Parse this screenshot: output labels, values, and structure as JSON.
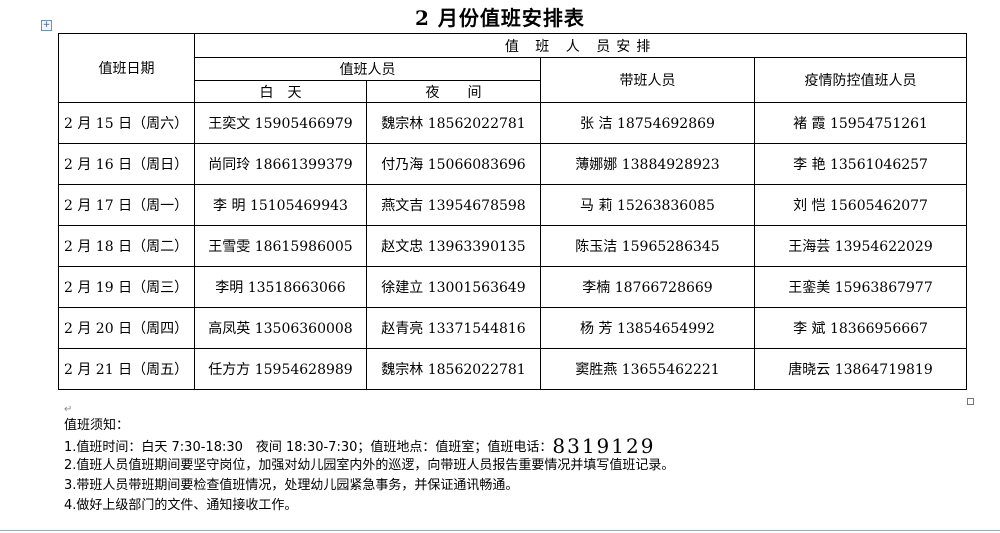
{
  "title": "2 月份值班安排表",
  "table": {
    "date_header": "值班日期",
    "arrangement_header": "值 班 人 员安排",
    "duty_staff_header": "值班人员",
    "day_header": "白　天",
    "night_header": "夜　　间",
    "lead_header": "带班人员",
    "epidemic_header": "疫情防控值班人员",
    "rows": [
      {
        "date": "2 月 15 日（周六）",
        "day": "王奕文 15905466979",
        "night": "魏宗林 18562022781",
        "lead": "张 洁 18754692869",
        "epi": "褚 霞 15954751261"
      },
      {
        "date": "2 月 16 日（周日）",
        "day": "尚同玲 18661399379",
        "night": "付乃海 15066083696",
        "lead": "薄娜娜 13884928923",
        "epi": "李 艳 13561046257"
      },
      {
        "date": "2 月 17 日（周一）",
        "day": "李 明 15105469943",
        "night": "燕文吉 13954678598",
        "lead": "马 莉 15263836085",
        "epi": "刘 恺 15605462077"
      },
      {
        "date": "2 月 18 日（周二）",
        "day": "王雪雯 18615986005",
        "night": "赵文忠 13963390135",
        "lead": "陈玉洁 15965286345",
        "epi": "王海芸 13954622029"
      },
      {
        "date": "2 月 19 日（周三）",
        "day": "李明 13518663066",
        "night": "徐建立 13001563649",
        "lead": "李楠 18766728669",
        "epi": "王銮美 15963867977"
      },
      {
        "date": "2 月 20 日（周四）",
        "day": "高凤英 13506360008",
        "night": "赵青亮 13371544816",
        "lead": "杨 芳 13854654992",
        "epi": "李 斌 18366956667"
      },
      {
        "date": "2 月 21 日（周五）",
        "day": "任方方 15954628989",
        "night": "魏宗林 18562022781",
        "lead": "窦胜燕 13655462221",
        "epi": "唐晓云 13864719819"
      }
    ]
  },
  "notes": {
    "heading": "值班须知：",
    "line1_prefix": "1.值班时间：白天 7:30-18:30　夜间 18:30-7:30；值班地点：值班室；值班电话：",
    "phone": "8319129",
    "line2": "2.值班人员值班期间要坚守岗位，加强对幼儿园室内外的巡逻，向带班人员报告重要情况并填写值班记录。",
    "line3": "3.带班人员带班期间要检查值班情况，处理幼儿园紧急事务，并保证通讯畅通。",
    "line4": "4.做好上级部门的文件、通知接收工作。"
  }
}
